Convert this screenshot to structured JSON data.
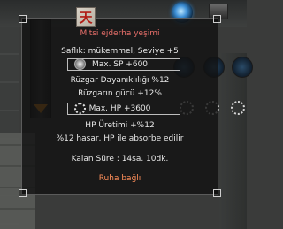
{
  "item": {
    "name": "Mitsi ejderha yeşimi",
    "icon_glyph": "天",
    "icon": "jade-stone-icon",
    "color_name": "#e86f6a",
    "color_stat": "#ff8f5a"
  },
  "stats": {
    "quality": "Saflık: mükemmel, Seviye +5",
    "sp": "Max. SP +600",
    "wind_resist": "Rüzgar Dayanıklılığı %12",
    "wind_power": "Rüzgarın gücü +12%",
    "hp": "Max. HP +3600",
    "hp_regen": "HP Üretimi +%12",
    "absorb": "%12 hasar, HP ile absorbe edilir"
  },
  "footer": {
    "remaining": "Kalan Süre : 14sa. 10dk.",
    "soulbound": "Ruha bağlı"
  }
}
